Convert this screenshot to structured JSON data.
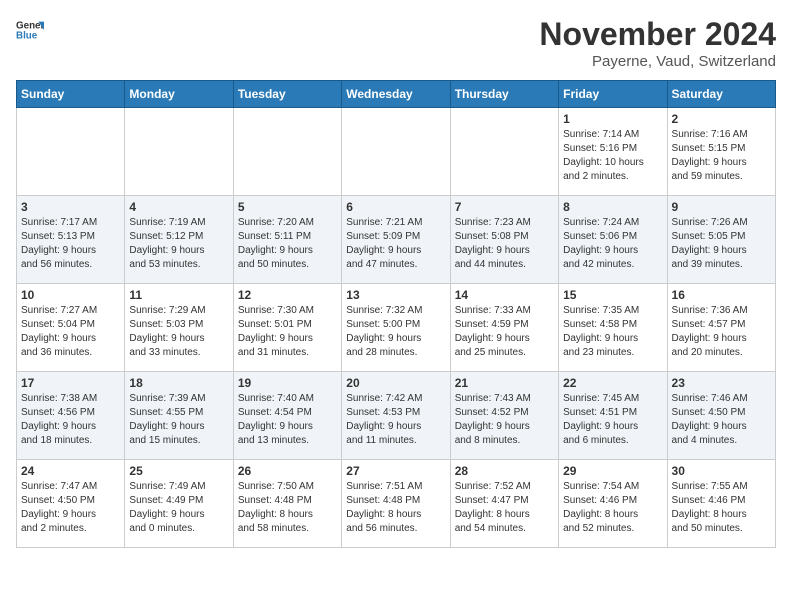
{
  "logo": {
    "general": "General",
    "blue": "Blue"
  },
  "header": {
    "month_year": "November 2024",
    "location": "Payerne, Vaud, Switzerland"
  },
  "days_of_week": [
    "Sunday",
    "Monday",
    "Tuesday",
    "Wednesday",
    "Thursday",
    "Friday",
    "Saturday"
  ],
  "weeks": [
    [
      {
        "day": "",
        "info": ""
      },
      {
        "day": "",
        "info": ""
      },
      {
        "day": "",
        "info": ""
      },
      {
        "day": "",
        "info": ""
      },
      {
        "day": "",
        "info": ""
      },
      {
        "day": "1",
        "info": "Sunrise: 7:14 AM\nSunset: 5:16 PM\nDaylight: 10 hours\nand 2 minutes."
      },
      {
        "day": "2",
        "info": "Sunrise: 7:16 AM\nSunset: 5:15 PM\nDaylight: 9 hours\nand 59 minutes."
      }
    ],
    [
      {
        "day": "3",
        "info": "Sunrise: 7:17 AM\nSunset: 5:13 PM\nDaylight: 9 hours\nand 56 minutes."
      },
      {
        "day": "4",
        "info": "Sunrise: 7:19 AM\nSunset: 5:12 PM\nDaylight: 9 hours\nand 53 minutes."
      },
      {
        "day": "5",
        "info": "Sunrise: 7:20 AM\nSunset: 5:11 PM\nDaylight: 9 hours\nand 50 minutes."
      },
      {
        "day": "6",
        "info": "Sunrise: 7:21 AM\nSunset: 5:09 PM\nDaylight: 9 hours\nand 47 minutes."
      },
      {
        "day": "7",
        "info": "Sunrise: 7:23 AM\nSunset: 5:08 PM\nDaylight: 9 hours\nand 44 minutes."
      },
      {
        "day": "8",
        "info": "Sunrise: 7:24 AM\nSunset: 5:06 PM\nDaylight: 9 hours\nand 42 minutes."
      },
      {
        "day": "9",
        "info": "Sunrise: 7:26 AM\nSunset: 5:05 PM\nDaylight: 9 hours\nand 39 minutes."
      }
    ],
    [
      {
        "day": "10",
        "info": "Sunrise: 7:27 AM\nSunset: 5:04 PM\nDaylight: 9 hours\nand 36 minutes."
      },
      {
        "day": "11",
        "info": "Sunrise: 7:29 AM\nSunset: 5:03 PM\nDaylight: 9 hours\nand 33 minutes."
      },
      {
        "day": "12",
        "info": "Sunrise: 7:30 AM\nSunset: 5:01 PM\nDaylight: 9 hours\nand 31 minutes."
      },
      {
        "day": "13",
        "info": "Sunrise: 7:32 AM\nSunset: 5:00 PM\nDaylight: 9 hours\nand 28 minutes."
      },
      {
        "day": "14",
        "info": "Sunrise: 7:33 AM\nSunset: 4:59 PM\nDaylight: 9 hours\nand 25 minutes."
      },
      {
        "day": "15",
        "info": "Sunrise: 7:35 AM\nSunset: 4:58 PM\nDaylight: 9 hours\nand 23 minutes."
      },
      {
        "day": "16",
        "info": "Sunrise: 7:36 AM\nSunset: 4:57 PM\nDaylight: 9 hours\nand 20 minutes."
      }
    ],
    [
      {
        "day": "17",
        "info": "Sunrise: 7:38 AM\nSunset: 4:56 PM\nDaylight: 9 hours\nand 18 minutes."
      },
      {
        "day": "18",
        "info": "Sunrise: 7:39 AM\nSunset: 4:55 PM\nDaylight: 9 hours\nand 15 minutes."
      },
      {
        "day": "19",
        "info": "Sunrise: 7:40 AM\nSunset: 4:54 PM\nDaylight: 9 hours\nand 13 minutes."
      },
      {
        "day": "20",
        "info": "Sunrise: 7:42 AM\nSunset: 4:53 PM\nDaylight: 9 hours\nand 11 minutes."
      },
      {
        "day": "21",
        "info": "Sunrise: 7:43 AM\nSunset: 4:52 PM\nDaylight: 9 hours\nand 8 minutes."
      },
      {
        "day": "22",
        "info": "Sunrise: 7:45 AM\nSunset: 4:51 PM\nDaylight: 9 hours\nand 6 minutes."
      },
      {
        "day": "23",
        "info": "Sunrise: 7:46 AM\nSunset: 4:50 PM\nDaylight: 9 hours\nand 4 minutes."
      }
    ],
    [
      {
        "day": "24",
        "info": "Sunrise: 7:47 AM\nSunset: 4:50 PM\nDaylight: 9 hours\nand 2 minutes."
      },
      {
        "day": "25",
        "info": "Sunrise: 7:49 AM\nSunset: 4:49 PM\nDaylight: 9 hours\nand 0 minutes."
      },
      {
        "day": "26",
        "info": "Sunrise: 7:50 AM\nSunset: 4:48 PM\nDaylight: 8 hours\nand 58 minutes."
      },
      {
        "day": "27",
        "info": "Sunrise: 7:51 AM\nSunset: 4:48 PM\nDaylight: 8 hours\nand 56 minutes."
      },
      {
        "day": "28",
        "info": "Sunrise: 7:52 AM\nSunset: 4:47 PM\nDaylight: 8 hours\nand 54 minutes."
      },
      {
        "day": "29",
        "info": "Sunrise: 7:54 AM\nSunset: 4:46 PM\nDaylight: 8 hours\nand 52 minutes."
      },
      {
        "day": "30",
        "info": "Sunrise: 7:55 AM\nSunset: 4:46 PM\nDaylight: 8 hours\nand 50 minutes."
      }
    ]
  ]
}
